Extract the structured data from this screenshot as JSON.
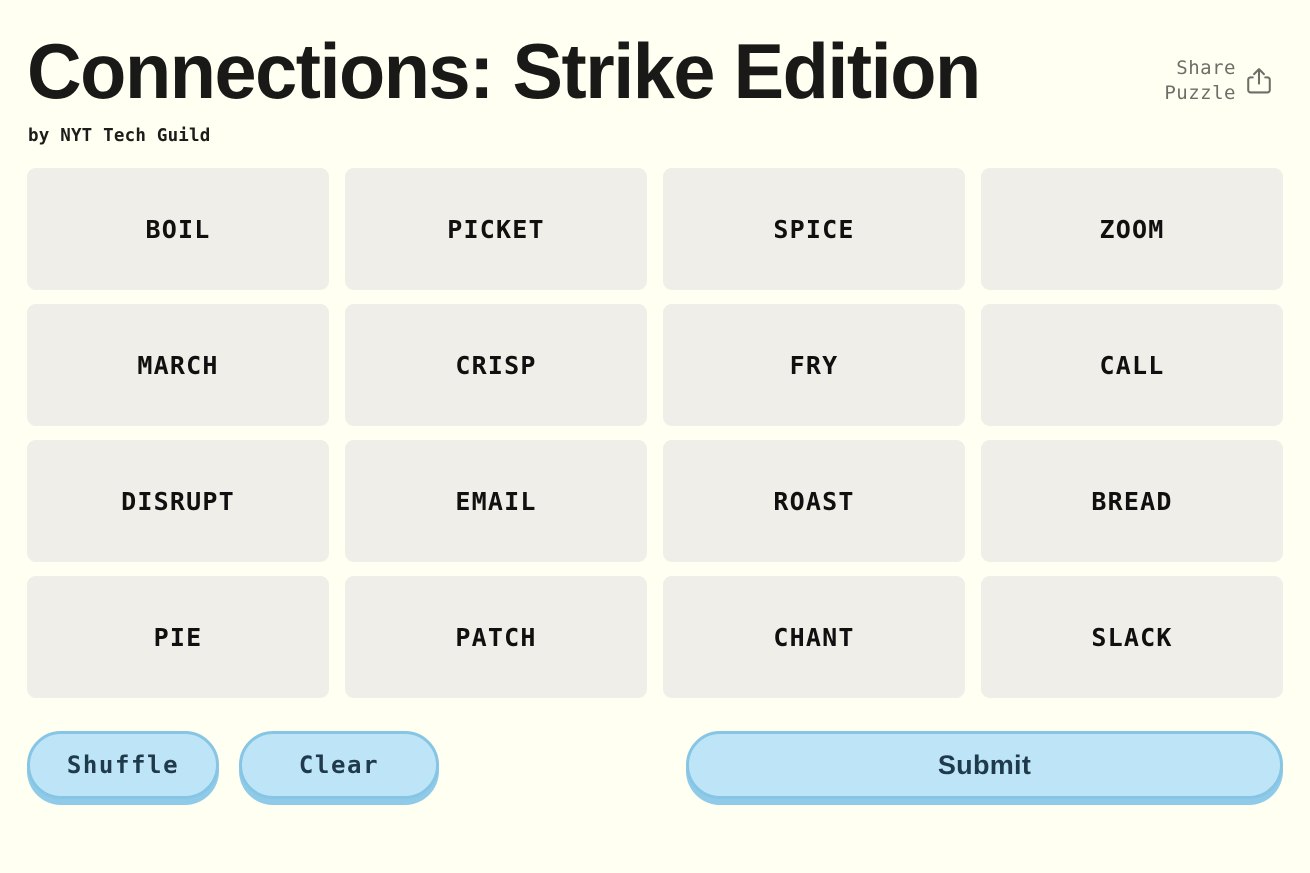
{
  "header": {
    "title": "Connections: Strike Edition",
    "subtitle": "by NYT Tech Guild",
    "share_label": "Share\nPuzzle",
    "share_icon": "share-icon"
  },
  "board": {
    "rows": [
      [
        "BOIL",
        "PICKET",
        "SPICE",
        "ZOOM"
      ],
      [
        "MARCH",
        "CRISP",
        "FRY",
        "CALL"
      ],
      [
        "DISRUPT",
        "EMAIL",
        "ROAST",
        "BREAD"
      ],
      [
        "PIE",
        "PATCH",
        "CHANT",
        "SLACK"
      ]
    ],
    "tiles": [
      "BOIL",
      "PICKET",
      "SPICE",
      "ZOOM",
      "MARCH",
      "CRISP",
      "FRY",
      "CALL",
      "DISRUPT",
      "EMAIL",
      "ROAST",
      "BREAD",
      "PIE",
      "PATCH",
      "CHANT",
      "SLACK"
    ]
  },
  "controls": {
    "shuffle_label": "Shuffle",
    "clear_label": "Clear",
    "submit_label": "Submit"
  },
  "colors": {
    "page_background": "#FFFFF2",
    "tile_background": "#EFEEE8",
    "tile_text": "#101010",
    "title_text": "#191917",
    "share_text": "#6E6E68",
    "button_fill": "#BEE4F8",
    "button_border": "#86C5E4",
    "button_shadow": "#8FCBE8",
    "button_text": "#1F3A4A"
  }
}
